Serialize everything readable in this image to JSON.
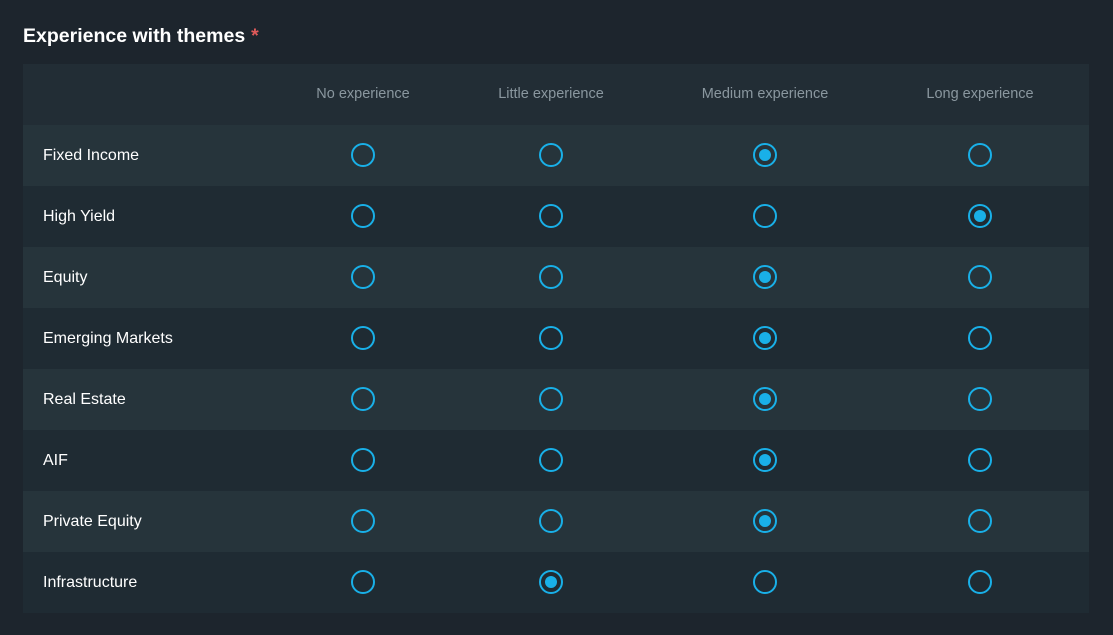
{
  "question": {
    "title": "Experience with themes",
    "required_mark": "*"
  },
  "columns": [
    "No experience",
    "Little experience",
    "Medium experience",
    "Long experience"
  ],
  "rows": [
    {
      "label": "Fixed Income",
      "selected": "Medium experience"
    },
    {
      "label": "High Yield",
      "selected": "Long experience"
    },
    {
      "label": "Equity",
      "selected": "Medium experience"
    },
    {
      "label": "Emerging Markets",
      "selected": "Medium experience"
    },
    {
      "label": "Real Estate",
      "selected": "Medium experience"
    },
    {
      "label": "AIF",
      "selected": "Medium experience"
    },
    {
      "label": "Private Equity",
      "selected": "Medium experience"
    },
    {
      "label": "Infrastructure",
      "selected": "Little experience"
    }
  ],
  "colors": {
    "accent": "#19b0e8",
    "required": "#e05a5a",
    "background": "#1d252d"
  },
  "icons": {
    "radio_unchecked": "radio-unchecked-icon",
    "radio_checked": "radio-checked-icon"
  }
}
